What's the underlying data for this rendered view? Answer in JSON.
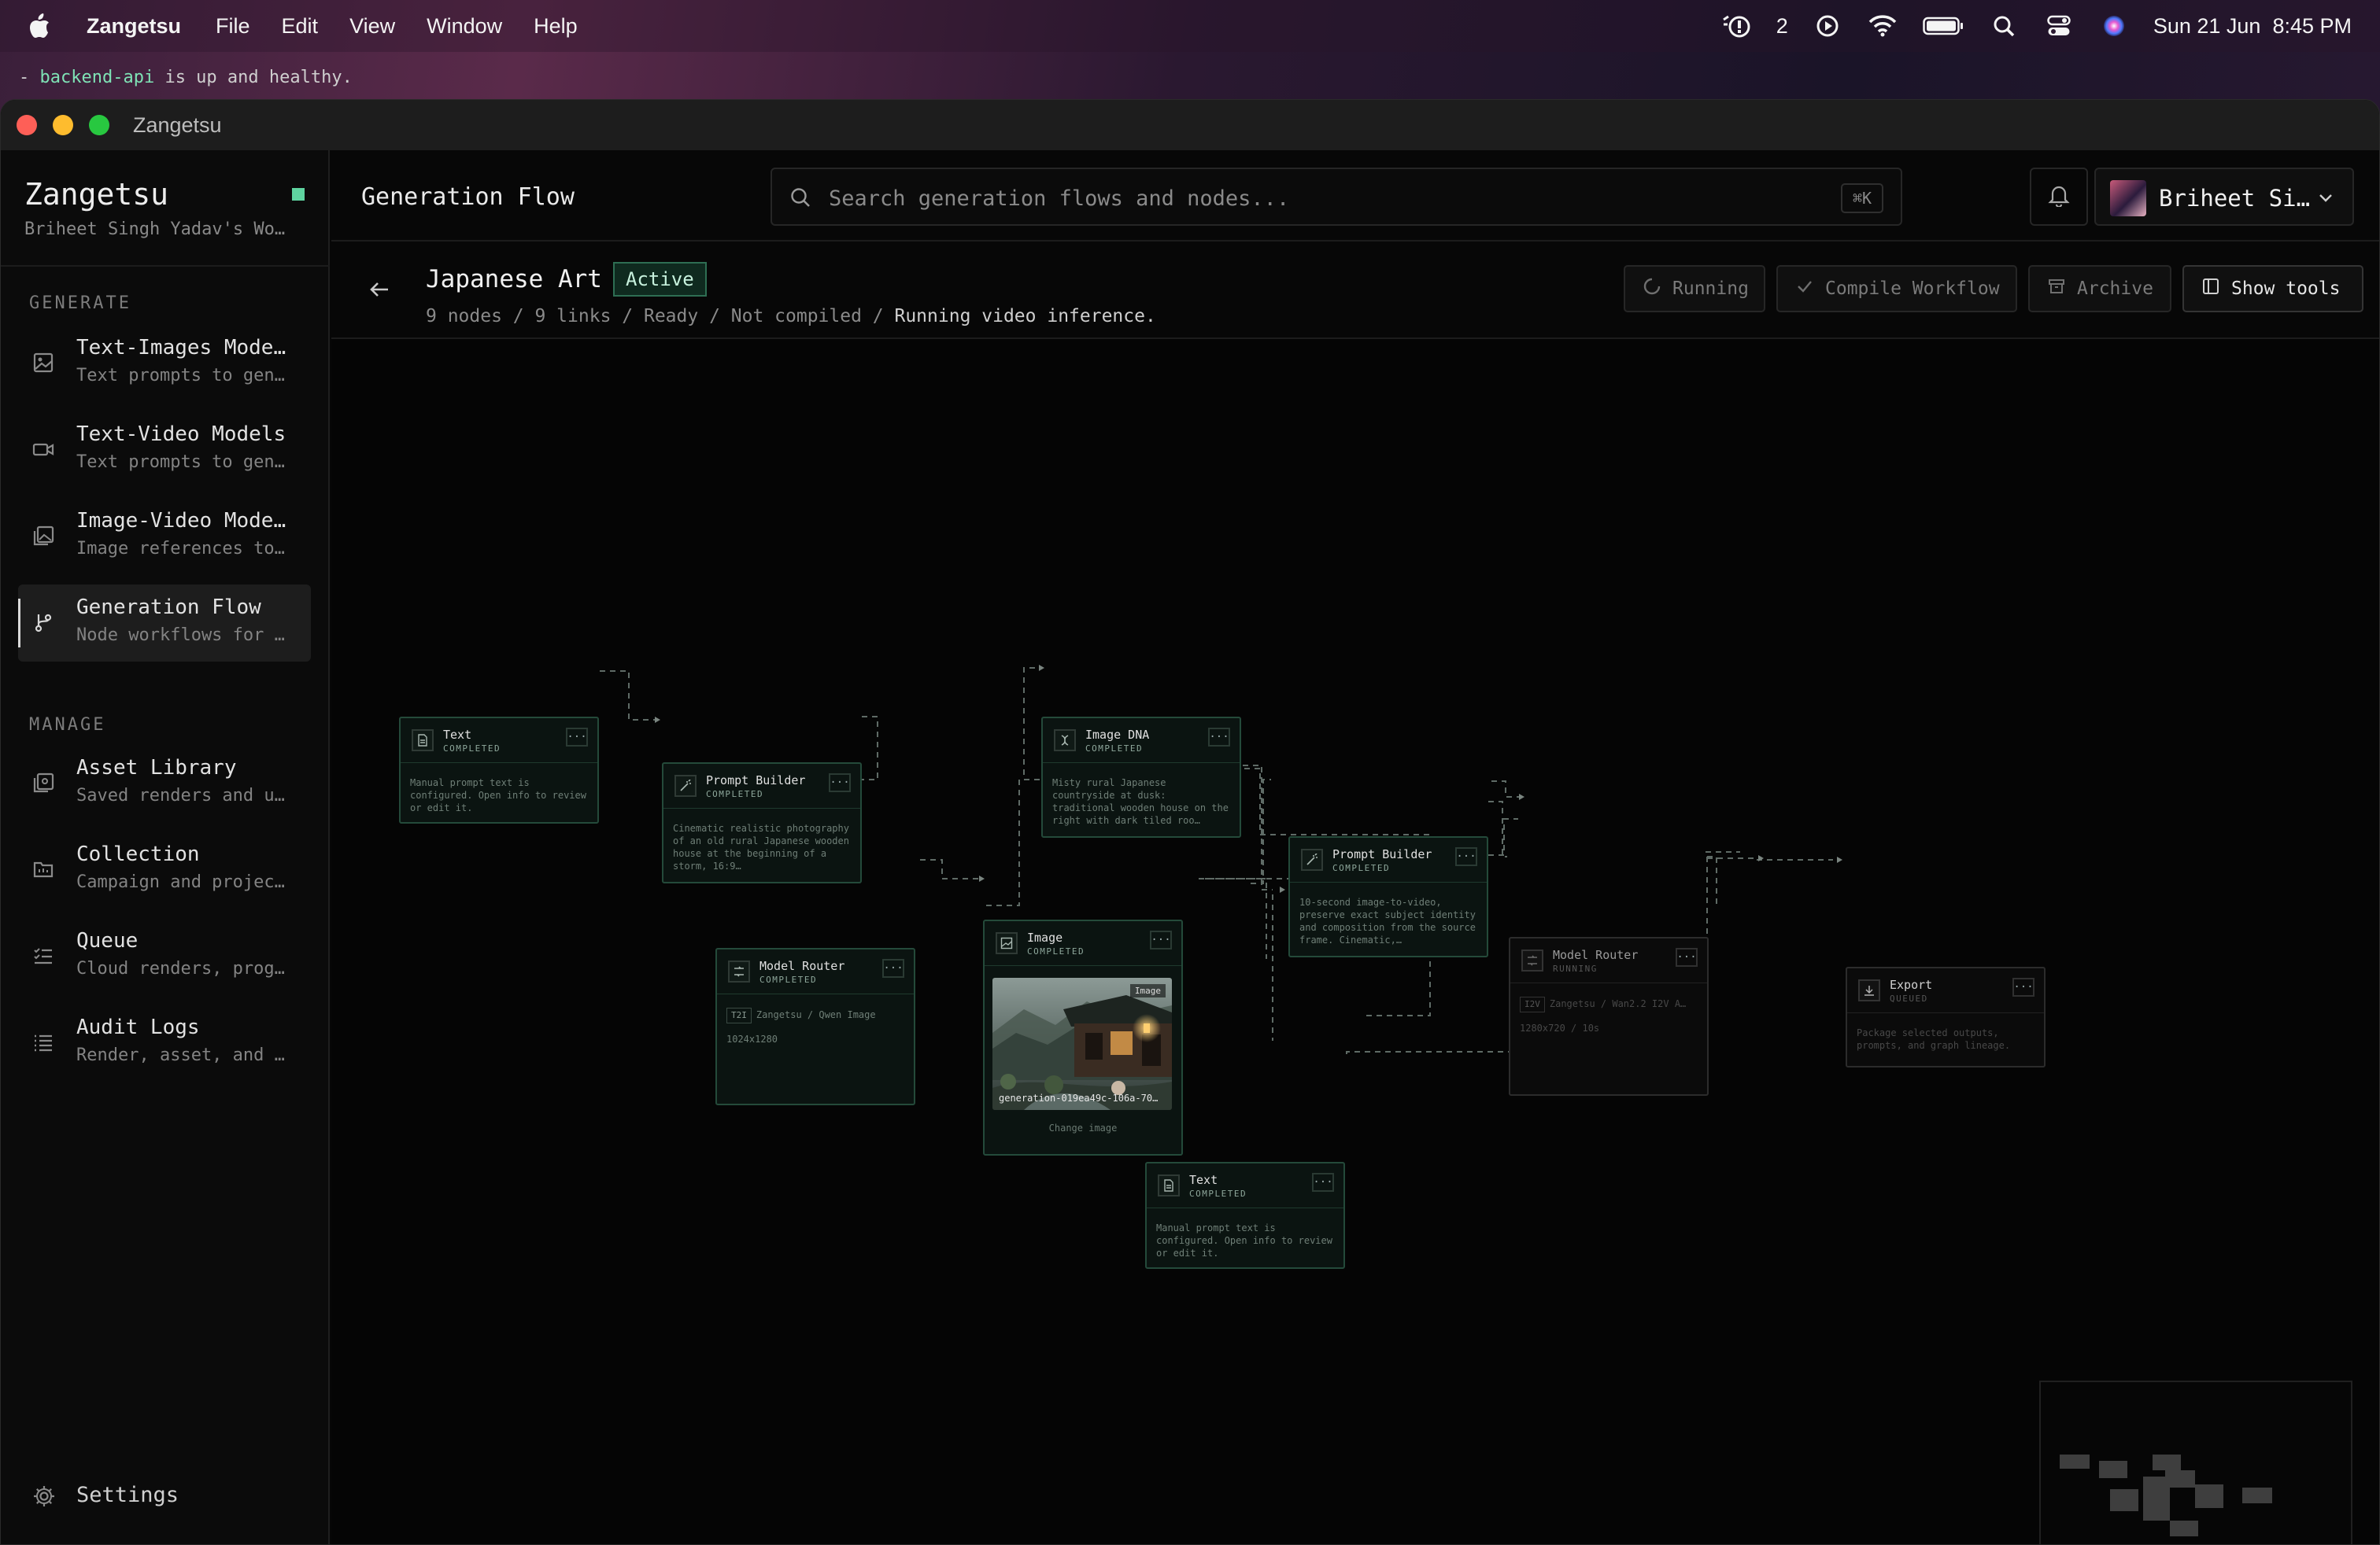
{
  "menubar": {
    "app": "Zangetsu",
    "items": [
      "File",
      "Edit",
      "View",
      "Window",
      "Help"
    ],
    "badge_count": "2",
    "datetime": "Sun 21 Jun  8:45 PM"
  },
  "terminal": {
    "line1_prefix": "- ",
    "line1_highlight": "backend-api",
    "line1_rest": " is up and healthy."
  },
  "window": {
    "title": "Zangetsu"
  },
  "sidebar": {
    "brand": "Zangetsu",
    "workspace": "Briheet Singh Yadav's Wo…",
    "sections": [
      {
        "label": "GENERATE",
        "items": [
          {
            "title": "Text-Images Mode…",
            "subtitle": "Text prompts to gen…",
            "icon": "image-icon"
          },
          {
            "title": "Text-Video Models",
            "subtitle": "Text prompts to gen…",
            "icon": "video-icon"
          },
          {
            "title": "Image-Video Mode…",
            "subtitle": "Image references to…",
            "icon": "images-icon"
          },
          {
            "title": "Generation Flow",
            "subtitle": "Node workflows for …",
            "icon": "flow-icon",
            "active": true
          }
        ]
      },
      {
        "label": "MANAGE",
        "items": [
          {
            "title": "Asset Library",
            "subtitle": "Saved renders and u…",
            "icon": "library-icon"
          },
          {
            "title": "Collection",
            "subtitle": "Campaign and projec…",
            "icon": "folder-icon"
          },
          {
            "title": "Queue",
            "subtitle": "Cloud renders, prog…",
            "icon": "queue-icon"
          },
          {
            "title": "Audit Logs",
            "subtitle": "Render, asset, and …",
            "icon": "list-icon"
          }
        ]
      }
    ],
    "settings": "Settings"
  },
  "header": {
    "title": "Generation Flow",
    "search_placeholder": "Search generation flows and nodes...",
    "search_shortcut": "⌘K",
    "user": "Briheet Si…"
  },
  "flow": {
    "name": "Japanese Art",
    "status": "Active",
    "meta": [
      "9 nodes",
      "9 links",
      "Ready",
      "Not compiled"
    ],
    "meta_current": "Running video inference.",
    "actions": {
      "running": "Running",
      "compile": "Compile Workflow",
      "archive": "Archive",
      "show_tools": "Show tools"
    }
  },
  "nodes": {
    "text1": {
      "title": "Text",
      "status": "COMPLETED",
      "body": "Manual prompt text is configured. Open info to review or edit it."
    },
    "prompt1": {
      "title": "Prompt Builder",
      "status": "COMPLETED",
      "body": "Cinematic realistic photography of an old rural Japanese wooden house at the beginning of a storm, 16:9…"
    },
    "router1": {
      "title": "Model Router",
      "status": "COMPLETED",
      "tag": "T2I",
      "model": "Zangetsu / Qwen Image",
      "size": "1024x1280"
    },
    "dna": {
      "title": "Image DNA",
      "status": "COMPLETED",
      "body": "Misty rural Japanese countryside at dusk: traditional wooden house on the right with dark tiled roo…"
    },
    "image": {
      "title": "Image",
      "status": "COMPLETED",
      "chip": "Image",
      "caption": "generation-019ea49c-106a-70…",
      "change": "Change image"
    },
    "text2": {
      "title": "Text",
      "status": "COMPLETED",
      "body": "Manual prompt text is configured. Open info to review or edit it."
    },
    "prompt2": {
      "title": "Prompt Builder",
      "status": "COMPLETED",
      "body": "10-second image-to-video, preserve exact subject identity and composition from the source frame. Cinematic,…"
    },
    "router2": {
      "title": "Model Router",
      "status": "RUNNING",
      "tag": "I2V",
      "model": "Zangetsu / Wan2.2 I2V A…",
      "size": "1280x720 / 10s"
    },
    "export": {
      "title": "Export",
      "status": "QUEUED",
      "body": "Package selected outputs, prompts, and graph lineage."
    }
  },
  "colors": {
    "accent_green": "#5fd4a0",
    "node_border": "#244a3a",
    "canvas_bg": "#050505",
    "traffic_red": "#fe5f57",
    "traffic_yellow": "#febc2e",
    "traffic_green": "#28c840"
  }
}
